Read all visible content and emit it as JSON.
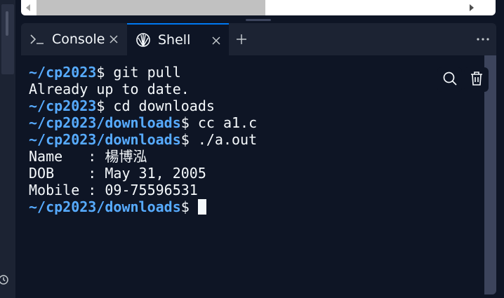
{
  "tabs": [
    {
      "label": "Console",
      "icon": "terminal-prompt-icon",
      "active": false
    },
    {
      "label": "Shell",
      "icon": "shell-icon",
      "active": true
    }
  ],
  "terminal": {
    "lines": [
      {
        "path": "~/cp2023",
        "rest": "$ git pull"
      },
      {
        "text": "Already up to date."
      },
      {
        "path": "~/cp2023",
        "rest": "$ cd downloads"
      },
      {
        "path": "~/cp2023/downloads",
        "rest": "$ cc a1.c"
      },
      {
        "path": "~/cp2023/downloads",
        "rest": "$ ./a.out"
      },
      {
        "text": "Name   : 楊博泓"
      },
      {
        "text": "DOB    : May 31, 2005"
      },
      {
        "text": "Mobile : 09-75596531"
      },
      {
        "path": "~/cp2023/downloads",
        "rest": "$ "
      }
    ]
  },
  "icons": {
    "search": "search-icon",
    "trash": "trash-icon",
    "more": "more-horizontal-icon",
    "add": "plus-icon",
    "close": "close-icon",
    "history": "history-icon"
  },
  "colors": {
    "background": "#0e1525",
    "panel": "#1c2333",
    "prompt_path": "#57abff",
    "active_tab_border": "#0079f2",
    "text": "#f5f9fc"
  }
}
